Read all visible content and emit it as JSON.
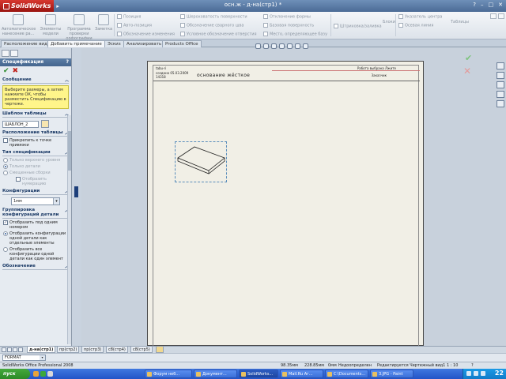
{
  "app": {
    "logo_text": "SolidWorks",
    "window_title": "осн.ж - д-на(стр1) *"
  },
  "ribbon": {
    "big_buttons": [
      {
        "label": "Автоматическое нанесение ра..."
      },
      {
        "label": "Элементы модели"
      },
      {
        "label": "Программа проверки орфографии"
      },
      {
        "label": "Заметка"
      }
    ],
    "small_col1": [
      "Позиция",
      "Авто-позиция",
      "Обозначение изменения"
    ],
    "small_col2": [
      "Шероховатость поверхности",
      "Обозначение сварного шва",
      "Условное обозначение отверстия"
    ],
    "small_col3": [
      "Отклонение формы",
      "Базовая поверхность",
      "Место, определяющее базу"
    ],
    "hatch_label": "Штриховка/заливка",
    "blocks_label": "Блоки",
    "small_col4": [
      "Указатель центра",
      "Осевая линия"
    ],
    "tables_label": "Таблицы"
  },
  "tabs": [
    {
      "label": "Расположение вида",
      "active": false
    },
    {
      "label": "Добавить примечание",
      "active": true
    },
    {
      "label": "Эскиз",
      "active": false
    },
    {
      "label": "Анализировать",
      "active": false
    },
    {
      "label": "Products Office",
      "active": false
    }
  ],
  "panel": {
    "title": "Спецификация",
    "help": "?",
    "ok_symbol": "✔",
    "cancel_symbol": "✖",
    "message_title": "Сообщение",
    "message_text": "Выберите размеры, а затем нажмите ОК, чтобы разместить Спецификацию в чертеже.",
    "template_title": "Шаблон таблицы",
    "template_value": "ШАБЛОН_2",
    "position_title": "Расположение таблицы",
    "anchor_label": "Прикрепить к точке привязки",
    "spec_type_title": "Тип спецификации",
    "spec_types": [
      {
        "label": "Только верхнего уровня",
        "on": false
      },
      {
        "label": "Только детали",
        "on": true
      },
      {
        "label": "Смещенные сборки",
        "on": false
      }
    ],
    "show_numbering_label": "Отобразить нумерацию",
    "config_title": "Конфигурации",
    "config_value": "1мм",
    "grouping_title": "Группировка конфигураций детали",
    "grouping_options": [
      {
        "label": "Отобразить под одним номером",
        "type": "checkbox",
        "on": true
      },
      {
        "label": "Отобразить конфигурации одной детали как отдельные элементы",
        "type": "radio",
        "on": true
      },
      {
        "label": "Отобразить все конфигурации одной детали как один элемент",
        "type": "radio",
        "on": false
      }
    ],
    "notation_title": "Обозначение"
  },
  "sheet": {
    "hdr_l1": "tabu-ri",
    "hdr_l2": "создано 05.03.2009",
    "hdr_l3": "14318",
    "title": "основание жёсткое",
    "hdr_r1": "Работа выбрана Лжите",
    "hdr_r2": "Заказчик"
  },
  "sheet_tabs": [
    "д-на(стр1)",
    "пр(стр2)",
    "пр(стр3)",
    "с8(стр4)",
    "с8(стр5)"
  ],
  "format_value": "FORMAT",
  "status": {
    "product": "SolidWorks Office Professional 2008",
    "x": "98.35мм",
    "y": "228.85мм",
    "z": "0мм",
    "state": "Недоопределен",
    "editing": "Редактируется Чертежный вид1",
    "scale": "1 : 10"
  },
  "taskbar": {
    "start_label": "пуск",
    "buttons": [
      {
        "label": "Форум неб...",
        "active": false
      },
      {
        "label": "Документ...",
        "active": false
      },
      {
        "label": "SolidWorks...",
        "active": true
      },
      {
        "label": "Mail.Ru Аг...",
        "active": false
      },
      {
        "label": "C:\\Documents...",
        "active": false
      },
      {
        "label": "3.JPG - Paint",
        "active": false
      }
    ],
    "clock": "22"
  }
}
